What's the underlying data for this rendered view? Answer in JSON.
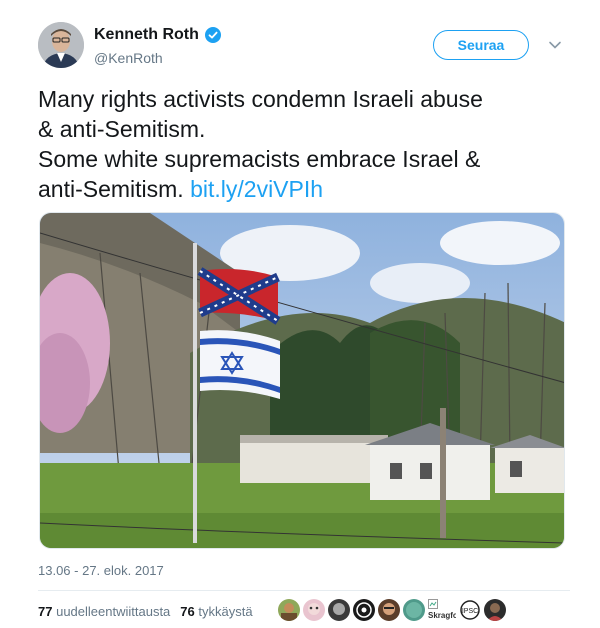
{
  "author": {
    "name": "Kenneth Roth",
    "handle": "@KenRoth",
    "verified": true,
    "avatar_icon": "profile-photo"
  },
  "follow_label": "Seuraa",
  "tweet": {
    "line1": "Many rights activists condemn Israeli abuse",
    "line2": "& anti-Semitism.",
    "line3": "Some white supremacists embrace Israel &",
    "line4": "anti-Semitism.",
    "link": "bit.ly/2viVPIh"
  },
  "media": {
    "description_icon": "photo-confederate-and-israeli-flags-on-pole"
  },
  "timestamp": "13.06 - 27. elok. 2017",
  "stats": {
    "retweets_count": "77",
    "retweets_label": "uudelleentwiittausta",
    "likes_count": "76",
    "likes_label": "tykkäystä"
  },
  "likers": {
    "last_label": "Skragfott"
  },
  "colors": {
    "accent": "#1da1f2",
    "text": "#14171a",
    "muted": "#657786"
  }
}
